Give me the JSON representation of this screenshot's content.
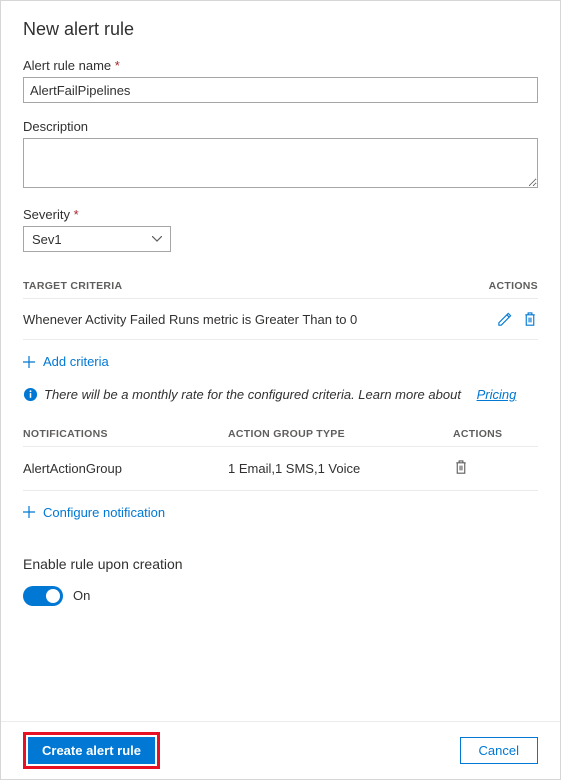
{
  "title": "New alert rule",
  "fields": {
    "name_label": "Alert rule name",
    "name_value": "AlertFailPipelines",
    "desc_label": "Description",
    "desc_value": "",
    "severity_label": "Severity",
    "severity_value": "Sev1"
  },
  "criteria": {
    "header_target": "TARGET CRITERIA",
    "header_actions": "ACTIONS",
    "row_text": "Whenever Activity Failed Runs metric is Greater Than to 0",
    "add_label": "Add criteria"
  },
  "info": {
    "text": "There will be a monthly rate for the configured criteria. Learn more about",
    "link_text": "Pricing"
  },
  "notifications": {
    "header_notifications": "NOTIFICATIONS",
    "header_group_type": "ACTION GROUP TYPE",
    "header_actions": "ACTIONS",
    "row_name": "AlertActionGroup",
    "row_type": "1 Email,1 SMS,1 Voice",
    "configure_label": "Configure notification"
  },
  "enable": {
    "label": "Enable rule upon creation",
    "state_label": "On"
  },
  "footer": {
    "primary": "Create alert rule",
    "cancel": "Cancel"
  }
}
